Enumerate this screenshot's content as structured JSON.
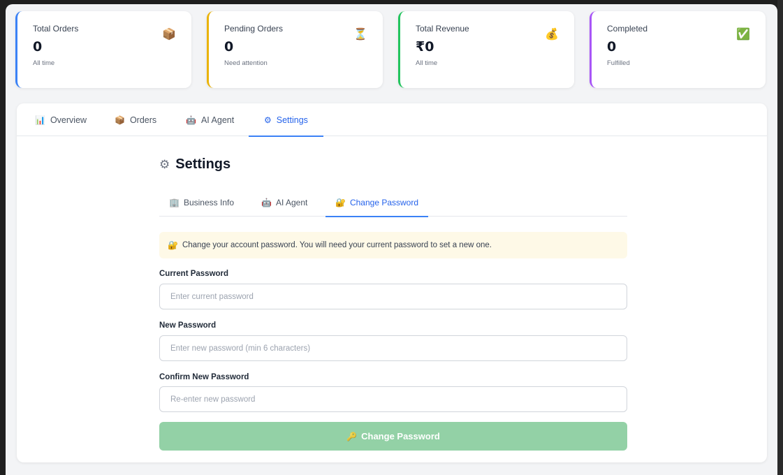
{
  "stats": [
    {
      "label": "Total Orders",
      "value": "0",
      "sub": "All time",
      "icon": "package-icon",
      "glyph": "📦",
      "color": "#3b82f6"
    },
    {
      "label": "Pending Orders",
      "value": "0",
      "sub": "Need attention",
      "icon": "hourglass-icon",
      "glyph": "⏳",
      "color": "#eab308"
    },
    {
      "label": "Total Revenue",
      "value": "₹0",
      "sub": "All time",
      "icon": "money-bag-icon",
      "glyph": "💰",
      "color": "#22c55e"
    },
    {
      "label": "Completed",
      "value": "0",
      "sub": "Fulfilled",
      "icon": "check-mark-icon",
      "glyph": "✅",
      "color": "#a855f7"
    }
  ],
  "tabs": [
    {
      "label": "Overview",
      "icon": "bar-chart-icon",
      "glyph": "📊"
    },
    {
      "label": "Orders",
      "icon": "package-icon",
      "glyph": "📦"
    },
    {
      "label": "AI Agent",
      "icon": "robot-icon",
      "glyph": "🤖"
    },
    {
      "label": "Settings",
      "icon": "gear-icon",
      "glyph": "⚙",
      "active": true
    }
  ],
  "settings": {
    "title": "Settings",
    "title_icon": "⚙",
    "subtabs": [
      {
        "label": "Business Info",
        "icon": "building-icon",
        "glyph": "🏢"
      },
      {
        "label": "AI Agent",
        "icon": "robot-icon",
        "glyph": "🤖"
      },
      {
        "label": "Change Password",
        "icon": "lock-key-icon",
        "glyph": "🔐",
        "active": true
      }
    ],
    "notice": {
      "icon": "lock-key-icon",
      "glyph": "🔐",
      "text": "Change your account password. You will need your current password to set a new one."
    },
    "fields": {
      "current": {
        "label": "Current Password",
        "placeholder": "Enter current password",
        "value": ""
      },
      "new": {
        "label": "New Password",
        "placeholder": "Enter new password (min 6 characters)",
        "value": ""
      },
      "confirm": {
        "label": "Confirm New Password",
        "placeholder": "Re-enter new password",
        "value": ""
      }
    },
    "submit": {
      "label": "Change Password",
      "icon": "key-icon",
      "glyph": "🔑",
      "color": "#93d1a6"
    }
  }
}
